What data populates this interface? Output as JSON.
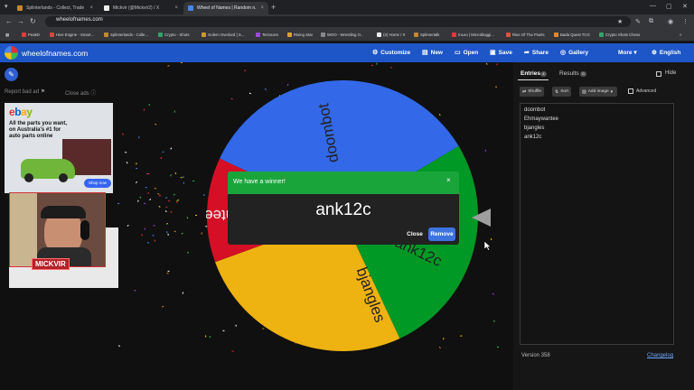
{
  "browser": {
    "tabs": [
      {
        "label": "Splinterlands - Collect, Trade",
        "fav": "#c28a2d"
      },
      {
        "label": "Mickvir (@Mickvir2) / X",
        "fav": "#111111"
      },
      {
        "label": "Wheel of Names | Random n...",
        "fav": "#4885ed"
      }
    ],
    "url": "wheelofnames.com",
    "bookmarks": [
      {
        "label": "PeakD",
        "color": "#e23b3b"
      },
      {
        "label": "Hive Engine - Smart...",
        "color": "#d14a3b"
      },
      {
        "label": "Splinterlands - Colle...",
        "color": "#c28a2d"
      },
      {
        "label": "Crypto - Shots",
        "color": "#2ea36b"
      },
      {
        "label": "Golem Overlord | S...",
        "color": "#c99a2f"
      },
      {
        "label": "Terracore",
        "color": "#9d4ad8"
      },
      {
        "label": "Rising Star",
        "color": "#e0a128"
      },
      {
        "label": "WOO - Wrestling O...",
        "color": "#888888"
      },
      {
        "label": "(3) Home / X",
        "color": "#111111"
      },
      {
        "label": "Splintertalk",
        "color": "#c28a2d"
      },
      {
        "label": "InLeo | Microbloggi...",
        "color": "#e23b3b"
      },
      {
        "label": "Rise Of The Pixels",
        "color": "#d9563a"
      },
      {
        "label": "Bada Quest TCG",
        "color": "#e88a2b"
      },
      {
        "label": "Crypto Shots Chess",
        "color": "#2ea36b"
      }
    ]
  },
  "site": {
    "name": "wheelofnames.com",
    "menu": [
      {
        "label": "Customize",
        "icon": "⚙"
      },
      {
        "label": "New",
        "icon": "▤"
      },
      {
        "label": "Open",
        "icon": "▭"
      },
      {
        "label": "Save",
        "icon": "▣"
      },
      {
        "label": "Share",
        "icon": "➦"
      },
      {
        "label": "Gallery",
        "icon": "◎"
      },
      {
        "label": "More ▾",
        "icon": ""
      },
      {
        "label": "English",
        "icon": "⊕"
      }
    ]
  },
  "sidebar": {
    "report_ad": "Report bad ad",
    "close_ads": "Close ads"
  },
  "ad": {
    "brand": "ebay",
    "headline": "All the parts you want, on Australia's #1 for auto parts online",
    "cta": "Shop now"
  },
  "webcam": {
    "label": "MICKVIR"
  },
  "wheel": {
    "segments": [
      {
        "name": "doombot",
        "color": "#3369e8"
      },
      {
        "name": "ank12c",
        "color": "#009925"
      },
      {
        "name": "bjangles",
        "color": "#eeb211"
      },
      {
        "name": "Ehmaywantee",
        "color": "#d50f25"
      }
    ]
  },
  "dialog": {
    "title": "We have a winner!",
    "winner": "ank12c",
    "close_label": "Close",
    "remove_label": "Remove",
    "x_label": "×"
  },
  "panel": {
    "tab_entries": "Entries",
    "entries_count": "4",
    "tab_results": "Results",
    "results_count": "0",
    "hide_label": "Hide",
    "shuffle_label": "Shuffle",
    "sort_label": "Sort",
    "add_image_label": "Add image",
    "advanced_label": "Advanced",
    "entries": [
      "doombot",
      "Ehmaywantee",
      "bjangles",
      "ank12c"
    ],
    "version": "Version 358",
    "changelog": "Changelog"
  },
  "colors": {
    "header_blue": "#1e56c7",
    "winner_green": "#1aa53b",
    "remove_blue": "#3d73e0"
  }
}
